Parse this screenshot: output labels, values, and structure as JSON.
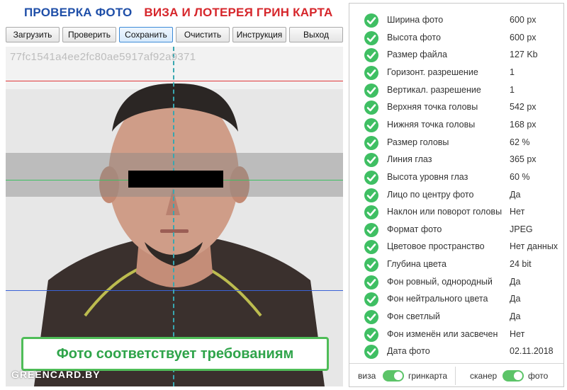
{
  "header": {
    "title_left": "ПРОВЕРКА ФОТО",
    "title_right": "ВИЗА И ЛОТЕРЕЯ ГРИН КАРТА",
    "colors": {
      "left": "#1f4fa8",
      "right": "#d6262b"
    }
  },
  "toolbar": {
    "buttons": [
      {
        "label": "Загрузить"
      },
      {
        "label": "Проверить"
      },
      {
        "label": "Сохранить",
        "active": true
      },
      {
        "label": "Очистить"
      },
      {
        "label": "Инструкция"
      },
      {
        "label": "Выход"
      }
    ]
  },
  "photo": {
    "hash": "77fc1541a4ee2fc80ae5917af92a9371",
    "guide_colors": {
      "top": "#e0373b",
      "eyes": "#3fbf63",
      "bottom": "#3a63d8",
      "center": "#38a7b0"
    },
    "site_mark": "GREENCARD.BY"
  },
  "banner": {
    "text": "Фото соответствует требованиям",
    "color": "#2fa44a"
  },
  "checks": [
    {
      "label": "Ширина фото",
      "value": "600 px"
    },
    {
      "label": "Высота фото",
      "value": "600 px"
    },
    {
      "label": "Размер файла",
      "value": "127 Kb"
    },
    {
      "label": "Горизонт. разрешение",
      "value": "1"
    },
    {
      "label": "Вертикал. разрешение",
      "value": "1"
    },
    {
      "label": "Верхняя точка головы",
      "value": "542 px"
    },
    {
      "label": "Нижняя точка головы",
      "value": "168 px"
    },
    {
      "label": "Размер головы",
      "value": "62 %"
    },
    {
      "label": "Линия глаз",
      "value": "365 px"
    },
    {
      "label": "Высота уровня глаз",
      "value": "60 %"
    },
    {
      "label": "Лицо по центру фото",
      "value": "Да"
    },
    {
      "label": "Наклон или поворот головы",
      "value": "Нет"
    },
    {
      "label": "Формат фото",
      "value": "JPEG"
    },
    {
      "label": "Цветовое пространство",
      "value": "Нет данных"
    },
    {
      "label": "Глубина цвета",
      "value": "24 bit"
    },
    {
      "label": "Фон ровный, однородный",
      "value": "Да"
    },
    {
      "label": "Фон нейтрального цвета",
      "value": "Да"
    },
    {
      "label": "Фон светлый",
      "value": "Да"
    },
    {
      "label": "Фон изменён или засвечен",
      "value": "Нет"
    },
    {
      "label": "Дата фото",
      "value": "02.11.2018"
    }
  ],
  "status_icon": "check-circle-icon",
  "status_color": "#3fbf63",
  "mode": {
    "toggle1": {
      "left": "виза",
      "right": "гринкарта",
      "on": true
    },
    "toggle2": {
      "left": "сканер",
      "right": "фото",
      "on": true
    }
  }
}
